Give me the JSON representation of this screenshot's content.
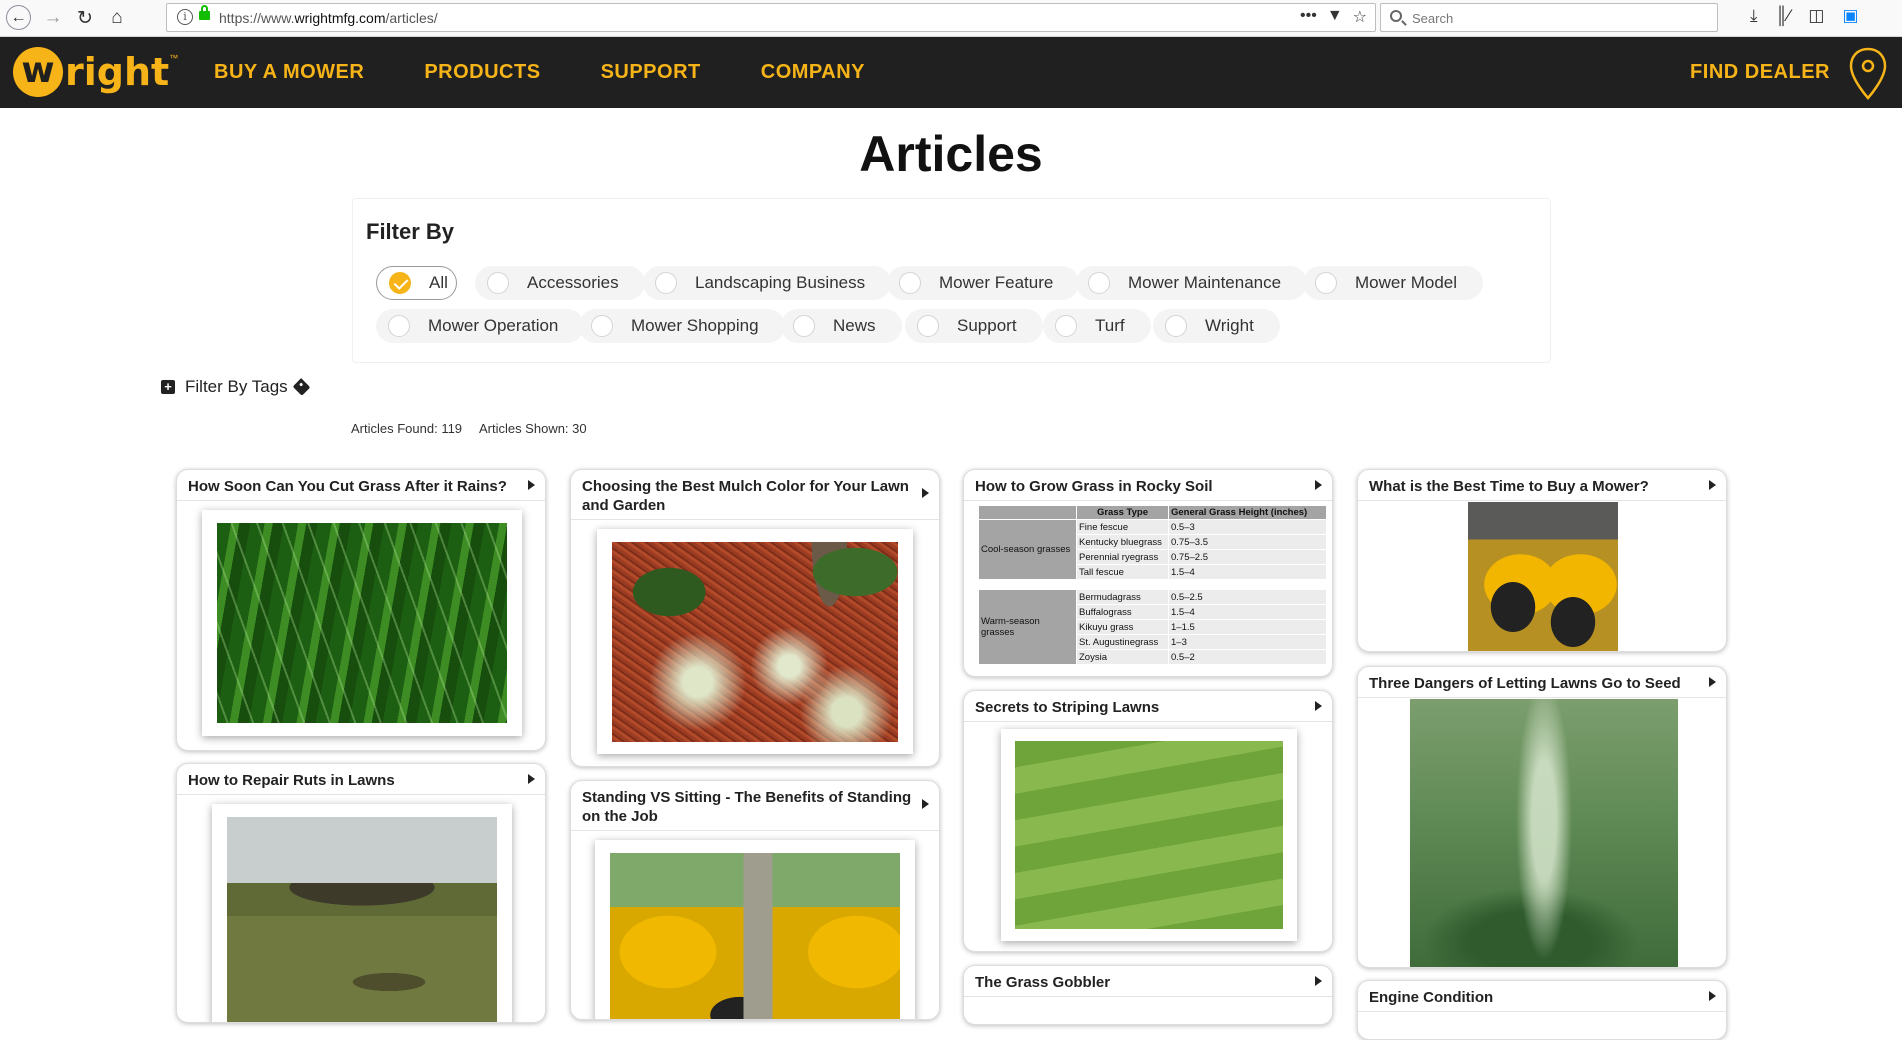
{
  "browser": {
    "url_prefix": "https://www.",
    "url_host": "wrightmfg.com",
    "url_path": "/articles/",
    "search_placeholder": "Search",
    "icons": [
      "back-icon",
      "forward-icon",
      "reload-icon",
      "home-icon",
      "info-icon",
      "lock-icon",
      "more-icon",
      "pocket-icon",
      "bookmark-star-icon",
      "download-icon",
      "library-icon",
      "sidebar-icon",
      "save-icon"
    ]
  },
  "header": {
    "logo_initial": "w",
    "logo_rest": "right",
    "logo_tm": "™",
    "nav": [
      "BUY A MOWER",
      "PRODUCTS",
      "SUPPORT",
      "COMPANY"
    ],
    "find_dealer": "FIND DEALER",
    "accent_color": "#f6b418",
    "bar_color": "#202020"
  },
  "page": {
    "title": "Articles",
    "filter_title": "Filter By",
    "filters": [
      "All",
      "Accessories",
      "Landscaping Business",
      "Mower Feature",
      "Mower Maintenance",
      "Mower Model",
      "Mower Operation",
      "Mower Shopping",
      "News",
      "Support",
      "Turf",
      "Wright"
    ],
    "active_filter": "All",
    "tags_label": "Filter By Tags",
    "articles_found": "Articles Found: 119",
    "articles_shown": "Articles Shown: 30"
  },
  "articles": {
    "a1": "How Soon Can You Cut Grass After it Rains?",
    "a2": "Choosing the Best Mulch Color for Your Lawn and Garden",
    "a3": "How to Grow Grass in Rocky Soil",
    "a4": "What is the Best Time to Buy a Mower?",
    "a5": "How to Repair Ruts in Lawns",
    "a6": "Standing VS Sitting - The Benefits of Standing on the Job",
    "a7": "Secrets to Striping Lawns",
    "a8": "Three Dangers of Letting Lawns Go to Seed",
    "a9": "The Grass Gobbler",
    "a10": "Engine Condition"
  },
  "grass_table": {
    "col1": "Grass Type",
    "col2": "General Grass Height (inches)",
    "cool_label": "Cool-season grasses",
    "cool": [
      {
        "name": "Fine fescue",
        "height": "0.5–3"
      },
      {
        "name": "Kentucky bluegrass",
        "height": "0.75–3.5"
      },
      {
        "name": "Perennial ryegrass",
        "height": "0.75–2.5"
      },
      {
        "name": "Tall fescue",
        "height": "1.5–4"
      }
    ],
    "warm_label": "Warm-season grasses",
    "warm": [
      {
        "name": "Bermudagrass",
        "height": "0.5–2.5"
      },
      {
        "name": "Buffalograss",
        "height": "1.5–4"
      },
      {
        "name": "Kikuyu grass",
        "height": "1–1.5"
      },
      {
        "name": "St. Augustinegrass",
        "height": "1–3"
      },
      {
        "name": "Zoysia",
        "height": "0.5–2"
      }
    ]
  }
}
